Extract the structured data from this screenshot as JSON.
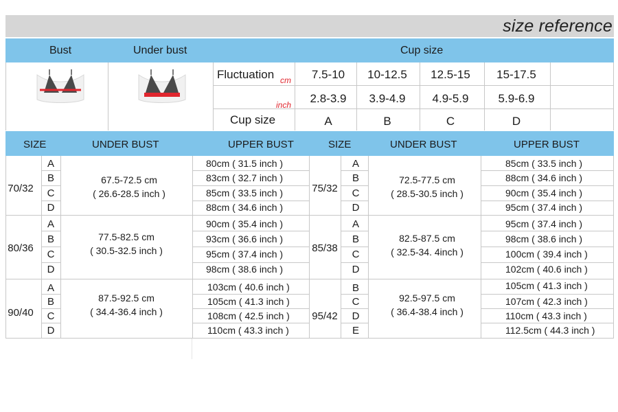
{
  "title": "size  reference",
  "header": {
    "bust": "Bust",
    "under_bust": "Under bust",
    "cup_size": "Cup size"
  },
  "fluctuation": {
    "label": "Fluctuation",
    "unit_cm": "cm",
    "unit_inch": "inch",
    "cm_values": [
      "7.5-10",
      "10-12.5",
      "12.5-15",
      "15-17.5"
    ],
    "inch_values": [
      "2.8-3.9",
      "3.9-4.9",
      "4.9-5.9",
      "5.9-6.9"
    ],
    "cup_label": "Cup size",
    "cups": [
      "A",
      "B",
      "C",
      "D"
    ]
  },
  "columns": {
    "size": "SIZE",
    "under_bust": "UNDER BUST",
    "upper_bust_left": "UPPER BUST",
    "upper_bust_right": "UPPER  BUST"
  },
  "groups": [
    {
      "left": {
        "size": "70/32",
        "letters": [
          "A",
          "B",
          "C",
          "D"
        ],
        "ub_cm": "67.5-72.5 cm",
        "ub_inch": "( 26.6-28.5 inch )",
        "upper": [
          "80cm (  31.5  inch )",
          "83cm (  32.7  inch )",
          "85cm (  33.5  inch )",
          "88cm (  34.6  inch )"
        ]
      },
      "right": {
        "size": "75/32",
        "letters": [
          "A",
          "B",
          "C",
          "D"
        ],
        "ub_cm": "72.5-77.5 cm",
        "ub_inch": "( 28.5-30.5 inch )",
        "upper": [
          "85cm (  33.5  inch )",
          "88cm (  34.6  inch )",
          "90cm (  35.4  inch )",
          "95cm (  37.4  inch )"
        ]
      }
    },
    {
      "left": {
        "size": "80/36",
        "letters": [
          "A",
          "B",
          "C",
          "D"
        ],
        "ub_cm": "77.5-82.5 cm",
        "ub_inch": "( 30.5-32.5 inch )",
        "upper": [
          "90cm (  35.4  inch )",
          "93cm (  36.6  inch )",
          "95cm (  37.4  inch )",
          "98cm (  38.6  inch )"
        ]
      },
      "right": {
        "size": "85/38",
        "letters": [
          "A",
          "B",
          "C",
          "D"
        ],
        "ub_cm": "82.5-87.5 cm",
        "ub_inch": "( 32.5-34. 4inch )",
        "upper": [
          "95cm (  37.4  inch )",
          "98cm (  38.6  inch )",
          "100cm (  39.4  inch )",
          "102cm (  40.6  inch )"
        ]
      }
    },
    {
      "left": {
        "size": "90/40",
        "letters": [
          "A",
          "B",
          "C",
          "D"
        ],
        "ub_cm": "87.5-92.5 cm",
        "ub_inch": "( 34.4-36.4 inch )",
        "upper": [
          "103cm (  40.6  inch )",
          "105cm (  41.3  inch )",
          "108cm (  42.5  inch )",
          "110cm (  43.3  inch )"
        ]
      },
      "right": {
        "size": "95/42",
        "letters": [
          "B",
          "C",
          "D",
          "E"
        ],
        "ub_cm": "92.5-97.5 cm",
        "ub_inch": "( 36.4-38.4 inch )",
        "upper": [
          "105cm (  41.3  inch )",
          "107cm (  42.3  inch )",
          "110cm (  43.3  inch )",
          "112.5cm (  44.3  inch )"
        ]
      }
    }
  ],
  "colors": {
    "header_blue": "#7fc4ea",
    "title_grey": "#d6d6d6",
    "measure_red": "#e0262e"
  }
}
